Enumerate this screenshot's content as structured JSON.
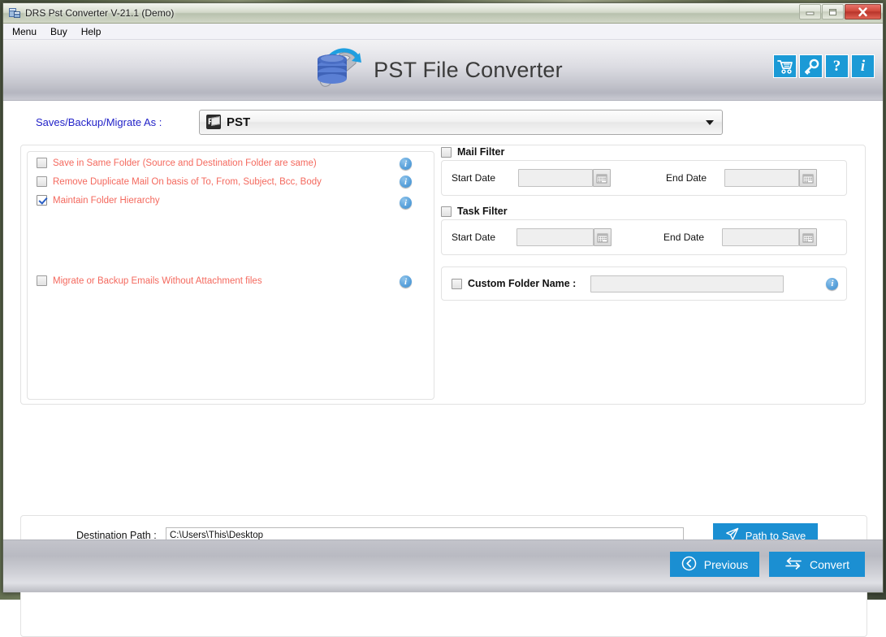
{
  "window": {
    "title": "DRS Pst Converter V-21.1 (Demo)",
    "app_icon": "app-window-icon",
    "controls": {
      "minimize": "minimize-icon",
      "maximize": "maximize-icon",
      "close": "close-icon"
    }
  },
  "menubar": {
    "items": [
      {
        "label": "Menu"
      },
      {
        "label": "Buy"
      },
      {
        "label": "Help"
      }
    ]
  },
  "header": {
    "brand_title": "PST File Converter",
    "logo": "database-wrench-logo",
    "icons": [
      {
        "name": "cart-icon",
        "glyph": ""
      },
      {
        "name": "key-icon",
        "glyph": ""
      },
      {
        "name": "help-icon",
        "glyph": "?"
      },
      {
        "name": "info-icon",
        "glyph": "i"
      }
    ]
  },
  "save_as": {
    "label": "Saves/Backup/Migrate As :",
    "selected": "PST",
    "file_icon": "pst-file-icon",
    "options": [
      "PST"
    ]
  },
  "options": {
    "checkboxes": [
      {
        "label": "Save in Same Folder (Source and Destination Folder are same)",
        "checked": false,
        "info": true
      },
      {
        "label": "Remove Duplicate Mail On basis of To, From, Subject, Bcc, Body",
        "checked": false,
        "info": true
      },
      {
        "label": "Maintain Folder Hierarchy",
        "checked": true,
        "info": true
      },
      {
        "label": "Migrate or Backup Emails Without Attachment files",
        "checked": false,
        "info": true
      }
    ]
  },
  "mail_filter": {
    "title": "Mail Filter",
    "checked": false,
    "start_label": "Start Date",
    "start_value": "",
    "end_label": "End Date",
    "end_value": "",
    "calendar_icon": "calendar-icon"
  },
  "task_filter": {
    "title": "Task Filter",
    "checked": false,
    "start_label": "Start Date",
    "start_value": "",
    "end_label": "End Date",
    "end_value": "",
    "calendar_icon": "calendar-icon"
  },
  "custom_folder": {
    "label": "Custom Folder Name :",
    "checked": false,
    "value": "",
    "info": true
  },
  "destination": {
    "label": "Destination Path :",
    "value": "C:\\Users\\This\\Desktop",
    "placeholder": "",
    "button_label": "Path to Save",
    "button_icon": "send-plane-icon"
  },
  "footer": {
    "previous_label": "Previous",
    "previous_icon": "circle-chevron-left-icon",
    "convert_label": "Convert",
    "convert_icon": "exchange-arrows-icon"
  },
  "colors": {
    "accent": "#1b8fd2",
    "link_blue": "#2323c8",
    "option_red": "#f4695e",
    "header_icon_blue": "#1b9ad6"
  }
}
